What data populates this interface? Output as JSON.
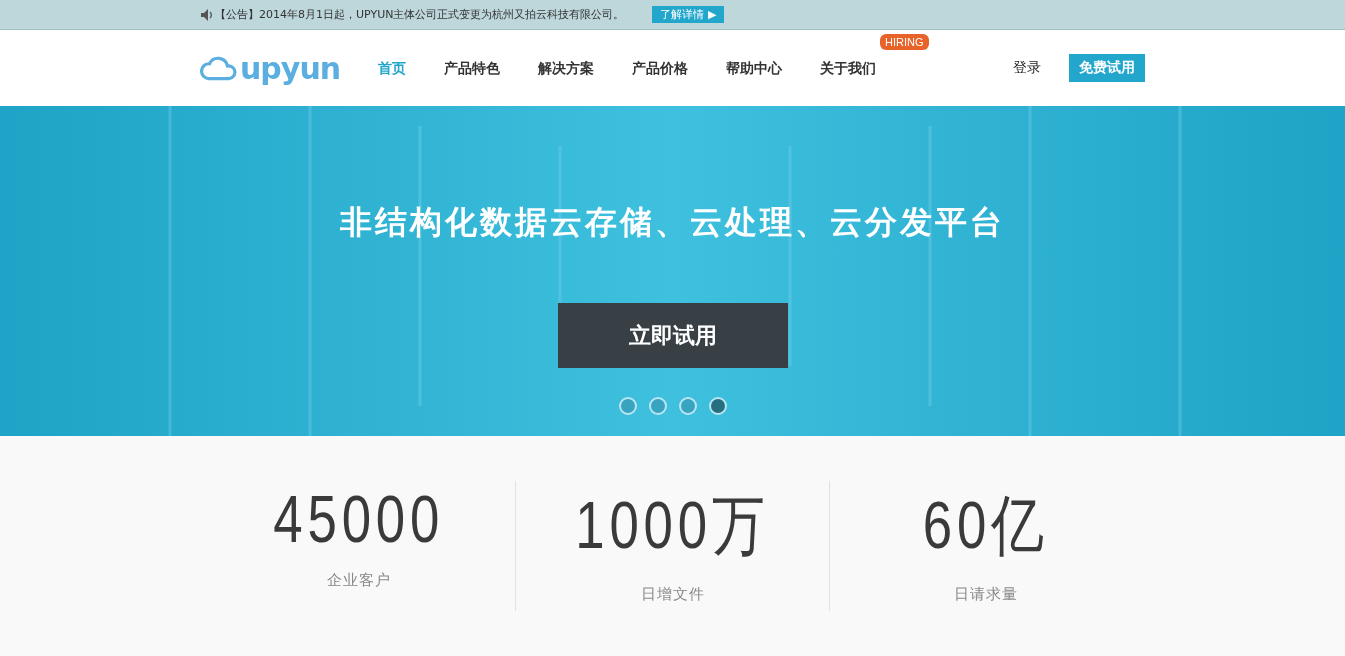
{
  "announcement": {
    "text": "【公告】2014年8月1日起，UPYUN主体公司正式变更为杭州又拍云科技有限公司。",
    "link": "了解详情 ▶"
  },
  "header": {
    "logo_text": "upyun",
    "nav": [
      {
        "label": "首页",
        "selected": true
      },
      {
        "label": "产品特色",
        "selected": false
      },
      {
        "label": "解决方案",
        "selected": false
      },
      {
        "label": "产品价格",
        "selected": false
      },
      {
        "label": "帮助中心",
        "selected": false
      },
      {
        "label": "关于我们",
        "selected": false,
        "badge": "HIRING"
      }
    ],
    "login": "登录",
    "trial_button": "免费试用"
  },
  "hero": {
    "title": "非结构化数据云存储、云处理、云分发平台",
    "button": "立即试用",
    "dots": [
      {
        "selected": false
      },
      {
        "selected": false
      },
      {
        "selected": false
      },
      {
        "selected": true
      }
    ]
  },
  "stats": [
    {
      "value": "45000",
      "label": "企业客户"
    },
    {
      "value": "1000万",
      "label": "日增文件"
    },
    {
      "value": "60亿",
      "label": "日请求量"
    }
  ]
}
